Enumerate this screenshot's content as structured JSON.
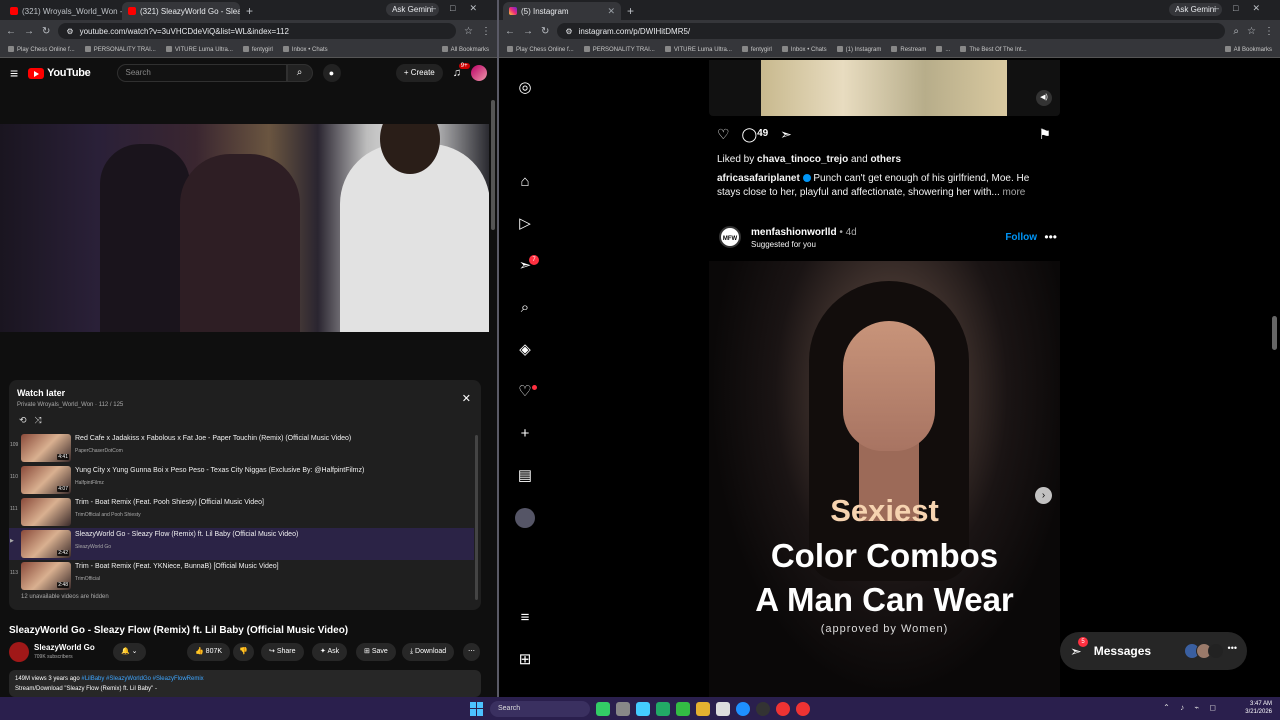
{
  "left_browser": {
    "tabs": [
      {
        "title": "(321) Wroyals_World_Won - Yo",
        "active": false
      },
      {
        "title": "(321) SleazyWorld Go - Sleazy F",
        "active": true
      }
    ],
    "gemini": "Ask Gemini",
    "url": "youtube.com/watch?v=3uVHCDdeViQ&list=WL&index=112",
    "bookmarks": [
      "Play Chess Online f...",
      "PERSONALITY TRAI...",
      "VITURE Luma Ultra...",
      "fentygirl",
      "Inbox • Chats"
    ],
    "all_bookmarks": "All Bookmarks"
  },
  "youtube": {
    "logo": "YouTube",
    "search_placeholder": "Search",
    "create_label": "Create",
    "notif_count": "9+",
    "watch_later": {
      "title": "Watch later",
      "subtitle": "Private Wroyals_World_Won · 112 / 125",
      "items": [
        {
          "n": "109",
          "title": "Red Cafe x Jadakiss x Fabolous x Fat Joe - Paper Touchin (Remix) (Official Music Video)",
          "channel": "PaperChaserDotCom",
          "duration": "4:41",
          "current": false
        },
        {
          "n": "110",
          "title": "Yung City x Yung Gunna Boi x Peso Peso - Texas City Niggas (Exclusive By: @HalfpintFilmz)",
          "channel": "HalfpintFilmz",
          "duration": "4:07",
          "current": false
        },
        {
          "n": "111",
          "title": "Trim - Boat Remix (Feat. Pooh Shiesty) [Official Music Video]",
          "channel": "TrimOfficial and Pooh Shiesty",
          "duration": "",
          "current": false
        },
        {
          "n": "▶",
          "title": "SleazyWorld Go - Sleazy Flow (Remix) ft. Lil Baby (Official Music Video)",
          "channel": "SleazyWorld Go",
          "duration": "2:42",
          "current": true
        },
        {
          "n": "113",
          "title": "Trim - Boat Remix (Feat. YKNiece, BunnaB) [Official Music Video]",
          "channel": "TrimOfficial",
          "duration": "2:48",
          "current": false
        }
      ],
      "hidden_note": "12 unavailable videos are hidden"
    },
    "video_title": "SleazyWorld Go - Sleazy Flow (Remix) ft. Lil Baby (Official Music Video)",
    "channel_name": "SleazyWorld Go",
    "channel_subs": "709K subscribers",
    "likes": "807K",
    "share": "Share",
    "ask": "Ask",
    "save": "Save",
    "download": "Download",
    "desc_meta": "149M views  3 years ago",
    "desc_tags": "#LilBaby #SleazyWorldGo #SleazyFlowRemix",
    "desc_line2": "Stream/Download \"Sleazy Flow (Remix) ft. Lil Baby\" -"
  },
  "right_browser": {
    "tab": "(5) Instagram",
    "gemini": "Ask Gemini",
    "url": "instagram.com/p/DWIHitDMR5/",
    "bookmarks": [
      "Play Chess Online f...",
      "PERSONALITY TRAI...",
      "VITURE Luma Ultra...",
      "fentygirl",
      "Inbox • Chats",
      "(1) Instagram",
      "Restream",
      "...",
      "The Best Of The Int..."
    ],
    "all_bookmarks": "All Bookmarks"
  },
  "instagram": {
    "notif_badge": "7",
    "comment_count": "49",
    "liked_prefix": "Liked by",
    "liked_user": "chava_tinoco_trejo",
    "liked_and": "and",
    "liked_others": "others",
    "caption_user": "africasafariplanet",
    "caption_text": "Punch can't get enough of his girlfriend, Moe. He stays close to her, playful and affectionate, showering her with...",
    "caption_more": "more",
    "post_user": "menfashionworlld",
    "post_avatar_text": "MFW",
    "post_age": "4d",
    "post_sub": "Suggested for you",
    "follow": "Follow",
    "overlay_line1": "Sexiest",
    "overlay_line2": "Color Combos",
    "overlay_line3": "A Man Can Wear",
    "overlay_line4": "(approved by Women)",
    "messages_label": "Messages",
    "messages_badge": "5"
  },
  "taskbar": {
    "search": "Search",
    "time": "3:47 AM",
    "date": "3/21/2026"
  }
}
